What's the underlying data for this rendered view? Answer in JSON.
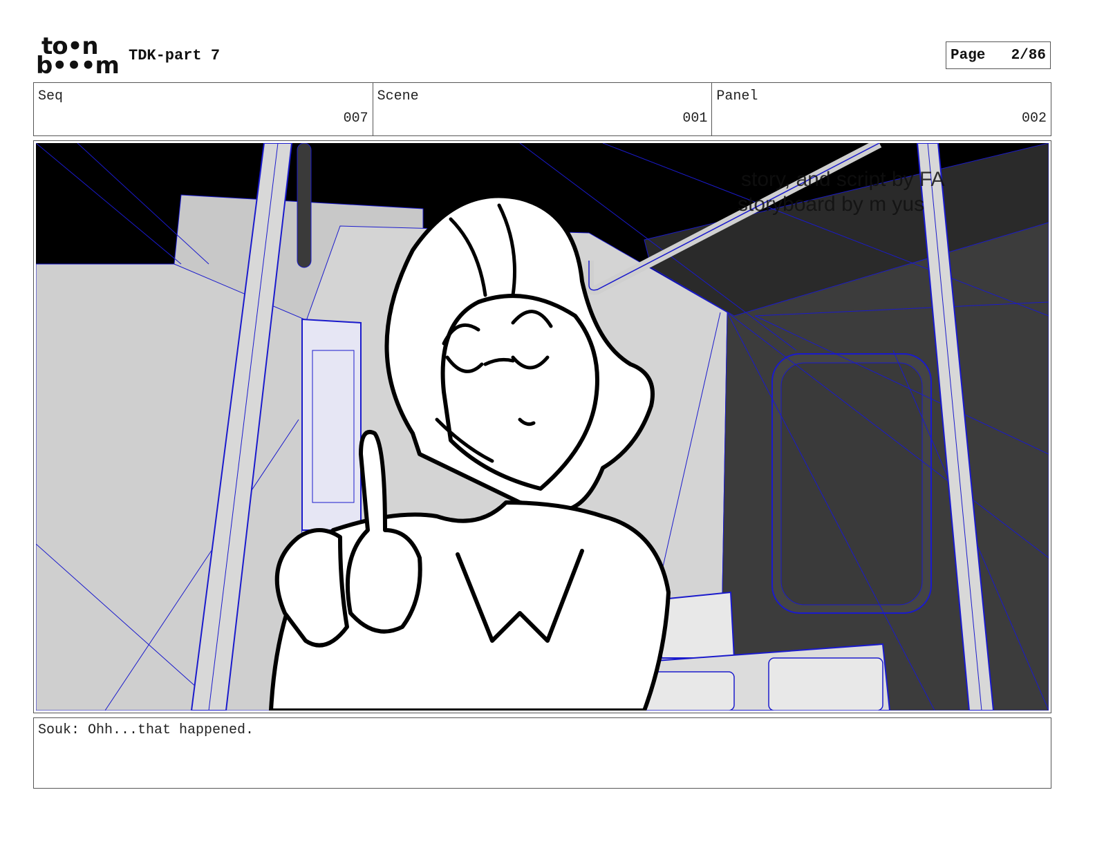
{
  "header": {
    "logo_line1": "to•n",
    "logo_line2": "b•••m",
    "title": "TDK-part 7",
    "page_label": "Page",
    "page_value": "2/86"
  },
  "fields": [
    {
      "label": "Seq",
      "value": "007"
    },
    {
      "label": "Scene",
      "value": "001"
    },
    {
      "label": "Panel",
      "value": "002"
    }
  ],
  "panel": {
    "overlay_line1": "story, and script by FA",
    "overlay_line2": "storyboard by m  yus"
  },
  "dialogue": "Souk: Ohh...that happened.",
  "colors": {
    "wire": "#1a1acc",
    "wall_light": "#cfcfcf",
    "wall_dark": "#3c3c3c",
    "ink": "#000000"
  }
}
